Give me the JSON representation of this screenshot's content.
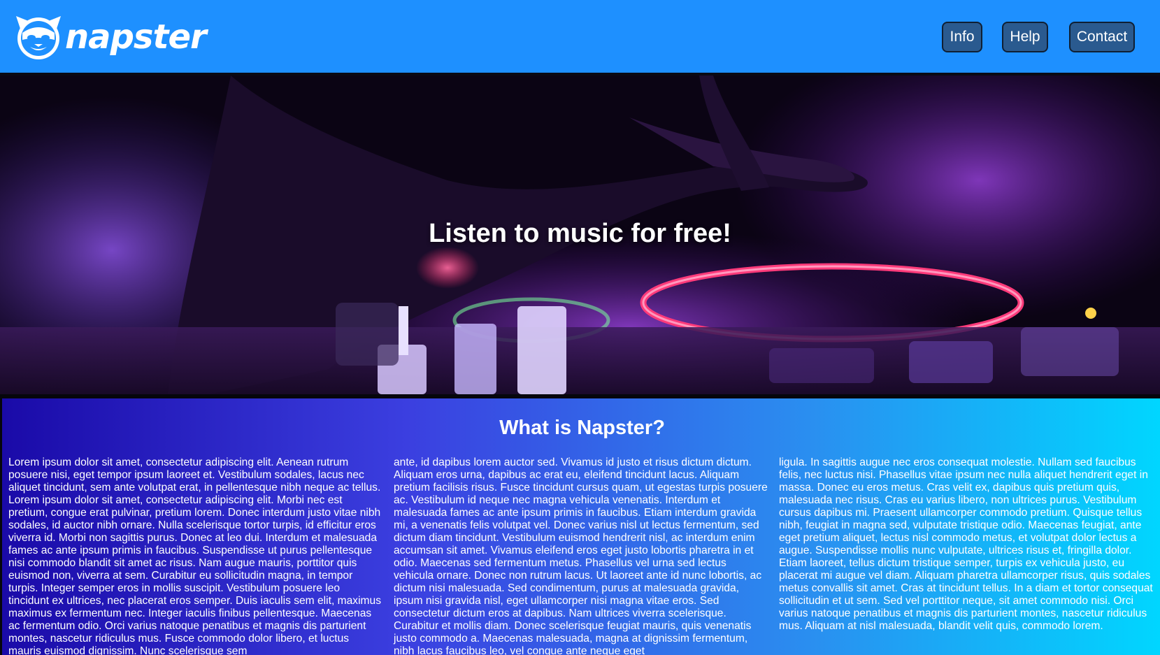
{
  "header": {
    "logo_text": "napster",
    "background_color": "#1e90ff",
    "nav": [
      {
        "label": "Info"
      },
      {
        "label": "Help"
      },
      {
        "label": "Contact"
      }
    ]
  },
  "hero": {
    "title": "Listen to music for free!",
    "image": "dj-turntable-purple-neon"
  },
  "about": {
    "title": "What is Napster?",
    "columns": [
      "Lorem ipsum dolor sit amet, consectetur adipiscing elit. Aenean rutrum posuere nisi, eget tempor ipsum laoreet et. Vestibulum sodales, lacus nec aliquet tincidunt, sem ante volutpat erat, in pellentesque nibh neque ac tellus. Lorem ipsum dolor sit amet, consectetur adipiscing elit. Morbi nec est pretium, congue erat pulvinar, pretium lorem. Donec interdum justo vitae nibh sodales, id auctor nibh ornare. Nulla scelerisque tortor turpis, id efficitur eros viverra id. Morbi non sagittis purus. Donec at leo dui. Interdum et malesuada fames ac ante ipsum primis in faucibus. Suspendisse ut purus pellentesque nisi commodo blandit sit amet ac risus. Nam augue mauris, porttitor quis euismod non, viverra at sem. Curabitur eu sollicitudin magna, in tempor turpis. Integer semper eros in mollis suscipit. Vestibulum posuere leo tincidunt ex ultrices, nec placerat eros semper. Duis iaculis sem elit, maximus maximus ex fermentum nec. Integer iaculis finibus pellentesque. Maecenas ac fermentum odio. Orci varius natoque penatibus et magnis dis parturient montes, nascetur ridiculus mus. Fusce commodo dolor libero, et luctus mauris euismod dignissim. Nunc scelerisque sem",
      "ante, id dapibus lorem auctor sed. Vivamus id justo et risus dictum dictum. Aliquam eros urna, dapibus ac erat eu, eleifend tincidunt lacus. Aliquam pretium facilisis risus. Fusce tincidunt cursus quam, ut egestas turpis posuere ac. Vestibulum id neque nec magna vehicula venenatis. Interdum et malesuada fames ac ante ipsum primis in faucibus. Etiam interdum gravida mi, a venenatis felis volutpat vel. Donec varius nisl ut lectus fermentum, sed dictum diam tincidunt. Vestibulum euismod hendrerit nisl, ac interdum enim accumsan sit amet. Vivamus eleifend eros eget justo lobortis pharetra in et odio. Maecenas sed fermentum metus. Phasellus vel urna sed lectus vehicula ornare. Donec non rutrum lacus. Ut laoreet ante id nunc lobortis, ac dictum nisi malesuada. Sed condimentum, purus at malesuada gravida, ipsum nisi gravida nisl, eget ullamcorper nisi magna vitae eros. Sed consectetur dictum eros at dapibus. Nam ultrices viverra scelerisque. Curabitur et mollis diam. Donec scelerisque feugiat mauris, quis venenatis justo commodo a. Maecenas malesuada, magna at dignissim fermentum, nibh lacus faucibus leo, vel congue ante neque eget",
      "ligula. In sagittis augue nec eros consequat molestie. Nullam sed faucibus felis, nec luctus nisi. Phasellus vitae ipsum nec nulla aliquet hendrerit eget in massa. Donec eu eros metus. Cras velit ex, dapibus quis pretium quis, malesuada nec risus. Cras eu varius libero, non ultrices purus. Vestibulum cursus dapibus mi. Praesent ullamcorper commodo pretium. Quisque tellus nibh, feugiat in magna sed, vulputate tristique odio. Maecenas feugiat, ante eget pretium aliquet, lectus nisl commodo metus, et volutpat dolor lectus a augue. Suspendisse mollis nunc vulputate, ultrices risus et, fringilla dolor. Etiam laoreet, tellus dictum tristique semper, turpis ex vehicula justo, eu placerat mi augue vel diam. Aliquam pharetra ullamcorper risus, quis sodales metus convallis sit amet. Cras at tincidunt tellus. In a diam et tortor consequat sollicitudin et ut sem. Sed vel porttitor neque, sit amet commodo nisi. Orci varius natoque penatibus et magnis dis parturient montes, nascetur ridiculus mus. Aliquam at nisl malesuada, blandit velit quis, commodo lorem."
    ]
  }
}
